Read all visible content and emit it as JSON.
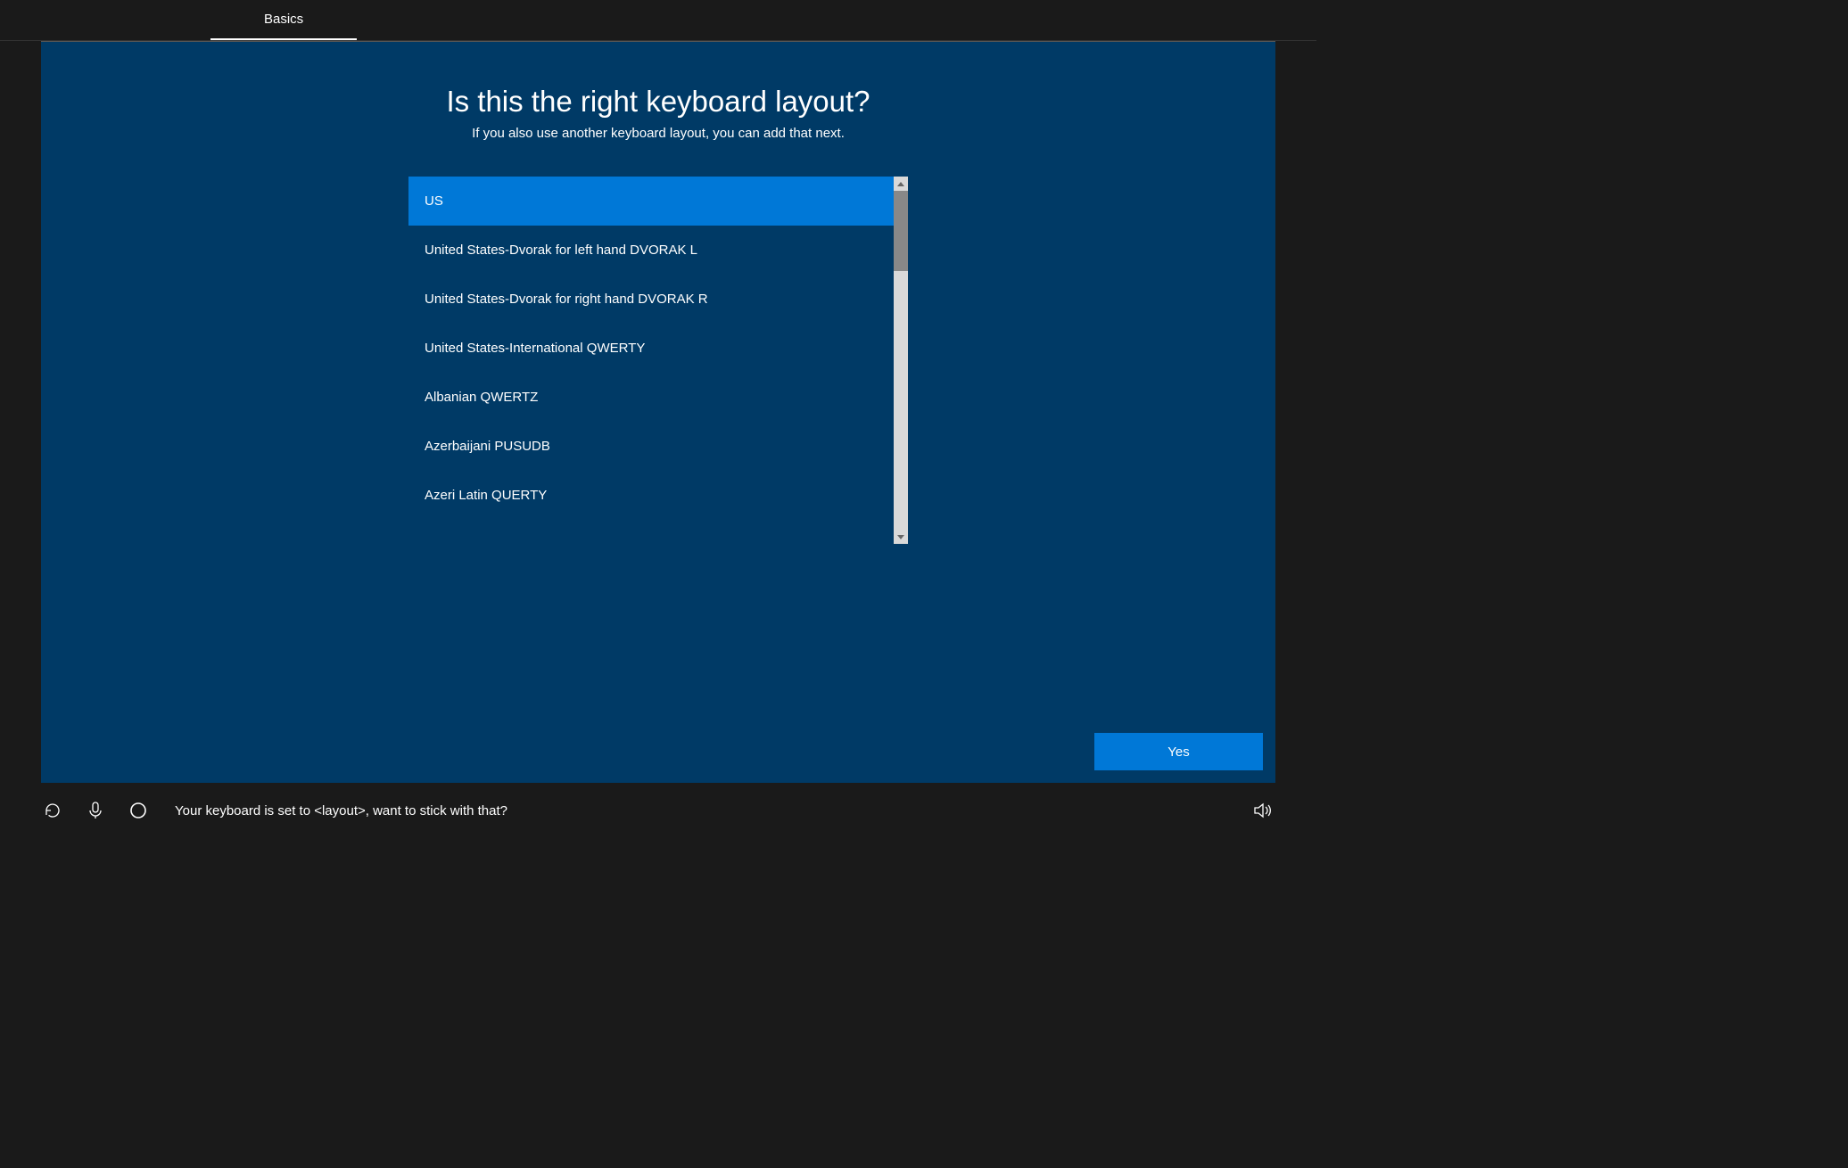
{
  "tab": {
    "label": "Basics"
  },
  "main": {
    "heading": "Is this the right keyboard layout?",
    "subheading": "If you also use another keyboard layout, you can add that next.",
    "items": [
      {
        "label": "US",
        "selected": true
      },
      {
        "label": "United States-Dvorak for left hand DVORAK L",
        "selected": false
      },
      {
        "label": "United States-Dvorak for right hand DVORAK R",
        "selected": false
      },
      {
        "label": "United States-International QWERTY",
        "selected": false
      },
      {
        "label": "Albanian QWERTZ",
        "selected": false
      },
      {
        "label": "Azerbaijani PUSUDB",
        "selected": false
      },
      {
        "label": "Azeri Latin QUERTY",
        "selected": false
      }
    ],
    "yes_label": "Yes"
  },
  "status": {
    "text": "Your keyboard is set to <layout>, want to stick with that?"
  }
}
